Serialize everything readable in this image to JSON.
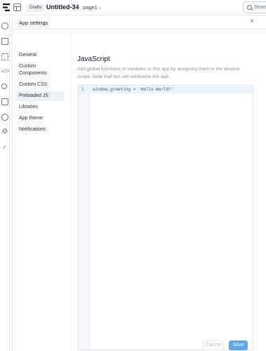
{
  "topbar": {
    "drafts_label": "Drafts",
    "app_name": "Untitled-34",
    "separator": "/",
    "page_name": "page1",
    "chevron": "⌄",
    "search_placeholder": "Search"
  },
  "rail": {
    "icons": [
      "play-circle-icon",
      "edit-icon",
      "components-icon",
      "code-icon",
      "search-icon",
      "inspector-icon",
      "history-icon",
      "settings-icon",
      "check-icon"
    ]
  },
  "modal": {
    "title": "App settings",
    "close_glyph": "×",
    "nav": [
      {
        "label": "General"
      },
      {
        "label": "Custom Components"
      },
      {
        "label": "Custom CSS"
      },
      {
        "label": "Preloaded JS",
        "active": true
      },
      {
        "label": "Libraries"
      },
      {
        "label": "App theme"
      },
      {
        "label": "Notifications"
      }
    ],
    "section_title": "JavaScript",
    "section_description": "Add global functions or variables to this app by assigning them to the window scope. Note that this will reinitialize the app.",
    "editor": {
      "line_number": "1",
      "code": "window.greeting = 'Hello World!'"
    },
    "cancel_label": "Cancel",
    "save_label": "Save"
  },
  "colors": {
    "accent": "#61a6ea",
    "active_nav": "#eef1f5",
    "active_line": "#eaf4fc"
  }
}
